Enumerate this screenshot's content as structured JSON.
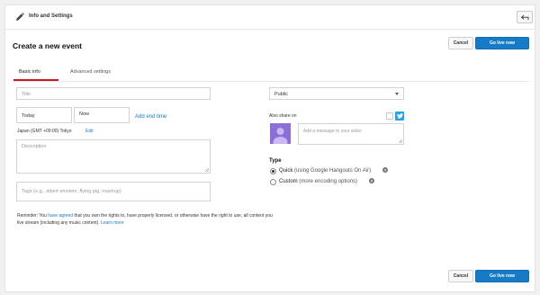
{
  "topbar": {
    "title": "Info and Settings"
  },
  "page": {
    "title": "Create a new event"
  },
  "actions": {
    "cancel_label": "Cancel",
    "go_live_label": "Go live now"
  },
  "tabs": [
    {
      "label": "Basic info"
    },
    {
      "label": "Advanced settings"
    }
  ],
  "form": {
    "title_placeholder": "Title",
    "date_value": "Today",
    "time_value": "Now",
    "add_end_time": "Add end time",
    "timezone": "Japan (GMT +09:00) Tokyo",
    "timezone_edit": "Edit",
    "description_placeholder": "Description",
    "tags_placeholder": "Tags (e.g., albert einstein, flying pig, mashup)"
  },
  "reminder": {
    "prefix": "Reminder: You ",
    "agreed_link": "have agreed",
    "middle": " that you own the rights to, have properly licensed, or otherwise have the right to use, all content you live stream (including any music content). ",
    "learn_more": "Learn more"
  },
  "privacy": {
    "selected": "Public"
  },
  "share": {
    "label": "Also share on",
    "message_placeholder": "Add a message to your video"
  },
  "type": {
    "label": "Type",
    "options": [
      {
        "name": "Quick",
        "detail": "(using Google Hangouts On Air)",
        "selected": true
      },
      {
        "name": "Custom",
        "detail": "(more encoding options)",
        "selected": false
      }
    ]
  },
  "colors": {
    "accent": "#167ac6",
    "tab_underline": "#cc181e",
    "twitter": "#1da1f2"
  }
}
